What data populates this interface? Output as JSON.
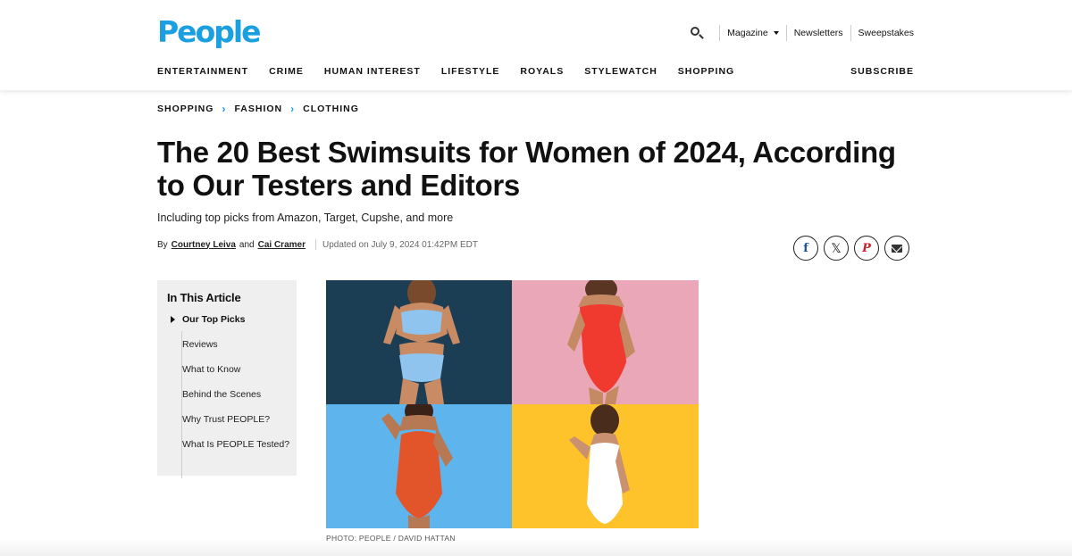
{
  "header": {
    "logo": "People",
    "util": {
      "magazine": "Magazine",
      "newsletters": "Newsletters",
      "sweepstakes": "Sweepstakes"
    },
    "nav": [
      "ENTERTAINMENT",
      "CRIME",
      "HUMAN INTEREST",
      "LIFESTYLE",
      "ROYALS",
      "STYLEWATCH",
      "SHOPPING"
    ],
    "subscribe": "SUBSCRIBE",
    "brand_color": "#1a9fe0"
  },
  "breadcrumb": [
    "SHOPPING",
    "FASHION",
    "CLOTHING"
  ],
  "article": {
    "headline": "The 20 Best Swimsuits for Women of 2024, According to Our Testers and Editors",
    "dek": "Including top picks from Amazon, Target, Cupshe, and more",
    "byline": {
      "by": "By",
      "author1": "Courtney Leiva",
      "and": "and",
      "author2": "Cai Cramer",
      "updated": "Updated on July 9, 2024 01:42PM EDT"
    },
    "share": {
      "facebook": "f",
      "x": "𝕏",
      "pinterest": "P",
      "email": "email"
    }
  },
  "toc": {
    "title": "In This Article",
    "items": [
      "Our Top Picks",
      "Reviews",
      "What to Know",
      "Behind the Scenes",
      "Why Trust PEOPLE?",
      "What Is PEOPLE Tested?"
    ]
  },
  "hero": {
    "tiles": [
      {
        "bg": "#1c3e54",
        "suit": "#8fc4ef"
      },
      {
        "bg": "#eaa7b8",
        "suit": "#f0392f"
      },
      {
        "bg": "#5eb4ec",
        "suit": "#e2552a"
      },
      {
        "bg": "#fec22a",
        "suit": "#ffffff"
      }
    ],
    "caption": "PHOTO: PEOPLE / DAVID HATTAN"
  }
}
